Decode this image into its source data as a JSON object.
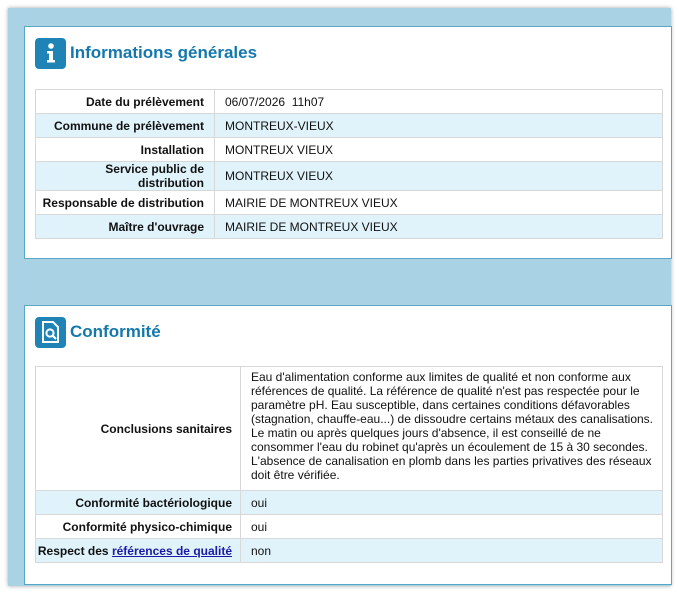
{
  "info_section": {
    "title": "Informations générales",
    "icon": "info-icon",
    "rows": [
      {
        "label": "Date du prélèvement",
        "value": "06/07/2026  11h07"
      },
      {
        "label": "Commune de prélèvement",
        "value": "MONTREUX-VIEUX"
      },
      {
        "label": "Installation",
        "value": "MONTREUX VIEUX"
      },
      {
        "label": "Service public de distribution",
        "value": "MONTREUX VIEUX"
      },
      {
        "label": "Responsable de distribution",
        "value": "MAIRIE DE MONTREUX VIEUX"
      },
      {
        "label": "Maître d'ouvrage",
        "value": "MAIRIE DE MONTREUX VIEUX"
      }
    ]
  },
  "conformity_section": {
    "title": "Conformité",
    "icon": "document-search-icon",
    "conclusions": {
      "label": "Conclusions sanitaires",
      "lines": [
        "Eau d'alimentation conforme aux limites de qualité et non conforme aux",
        "références de qualité. La référence de qualité n'est pas respectée pour le",
        "paramètre pH. Eau susceptible, dans certaines conditions défavorables",
        "(stagnation, chauffe-eau...) de dissoudre certains métaux des canalisations.",
        "Le matin ou après quelques jours d'absence, il est conseillé de ne",
        "consommer l'eau du robinet qu'après un écoulement de 15 à 30 secondes.",
        "L'absence de canalisation en plomb dans les parties privatives des réseaux",
        "doit être vérifiée."
      ]
    },
    "bacteriological": {
      "label": "Conformité bactériologique",
      "value": "oui"
    },
    "physicochemical": {
      "label": "Conformité physico-chimique",
      "value": "oui"
    },
    "quality_refs": {
      "label_prefix": "Respect des ",
      "link_text": "références de qualité",
      "value": "non"
    }
  },
  "colors": {
    "accent": "#1478ad",
    "icon_bg": "#1f84b5",
    "row_alt": "#e0f3fb",
    "frame_bg": "#a9d3e4",
    "link": "#1a1aa6"
  }
}
